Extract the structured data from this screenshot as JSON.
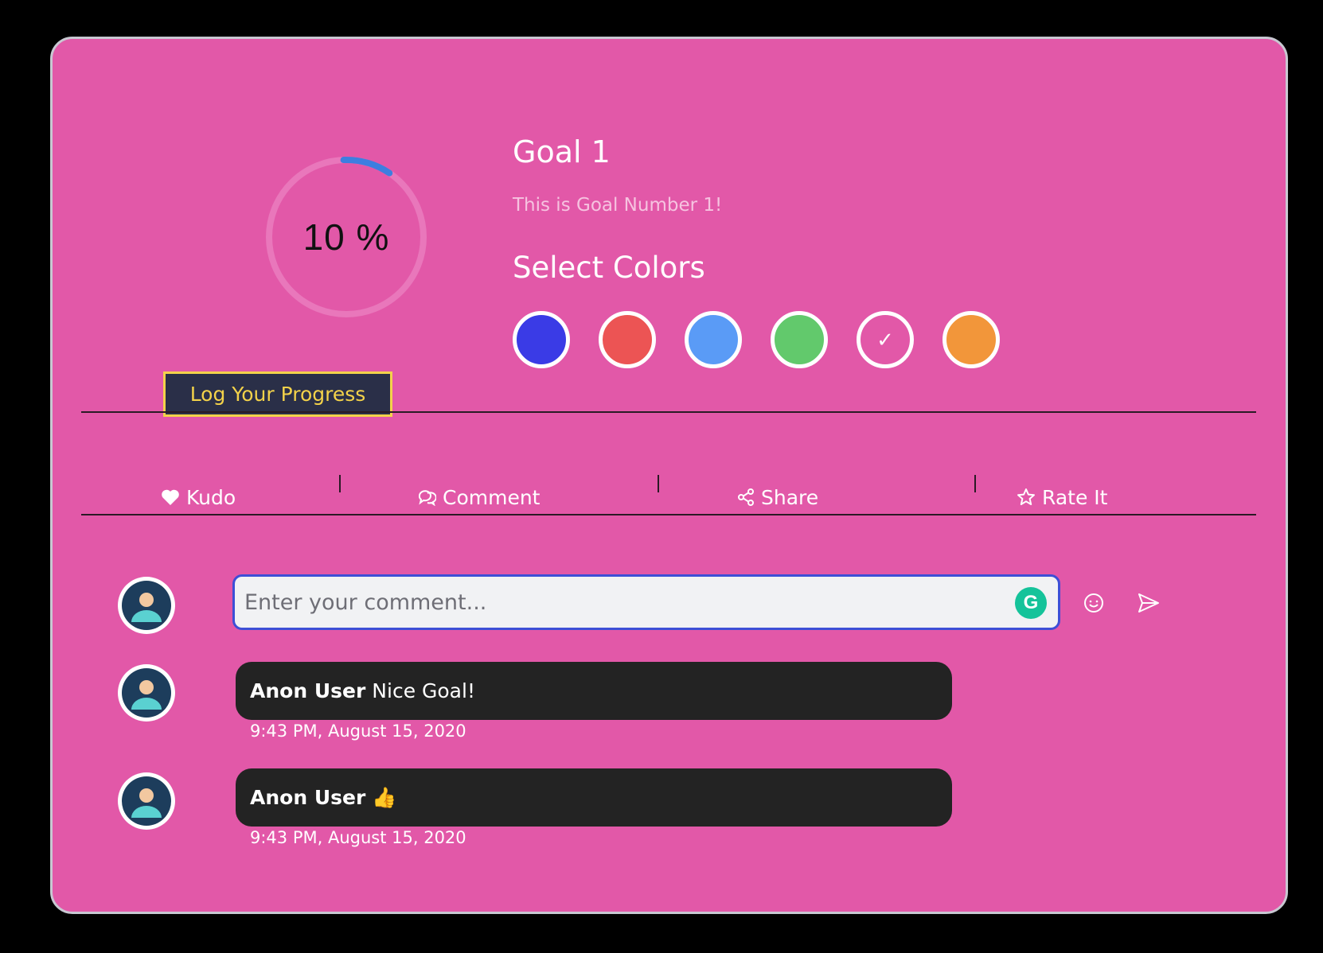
{
  "goal": {
    "progress_text": "10 %",
    "progress_value": 0.1,
    "title": "Goal 1",
    "description": "This is Goal Number 1!",
    "log_button_label": "Log Your Progress",
    "ring_color": "#3d7ee0"
  },
  "colors": {
    "title": "Select Colors",
    "swatches": [
      {
        "name": "blue",
        "hex": "#3a3be6",
        "selected": false
      },
      {
        "name": "red",
        "hex": "#ec5454",
        "selected": false
      },
      {
        "name": "light-blue",
        "hex": "#5a9bf6",
        "selected": false
      },
      {
        "name": "green",
        "hex": "#62c96c",
        "selected": false
      },
      {
        "name": "pink",
        "hex": "#e258a8",
        "selected": true,
        "check": "✓"
      },
      {
        "name": "orange",
        "hex": "#f2963a",
        "selected": false
      }
    ]
  },
  "actions": {
    "kudo": {
      "label": "Kudo",
      "icon": "heart-icon"
    },
    "comment": {
      "label": "Comment",
      "icon": "chat-bubbles-icon"
    },
    "share": {
      "label": "Share",
      "icon": "share-icon"
    },
    "rate": {
      "label": "Rate It",
      "icon": "star-icon"
    }
  },
  "comment_input": {
    "placeholder": "Enter your comment...",
    "grammarly_letter": "G",
    "emoji_icon": "smiley-icon",
    "send_icon": "send-icon"
  },
  "comments": [
    {
      "author": "Anon User",
      "text": "Nice Goal!",
      "time": "9:43 PM, August 15, 2020"
    },
    {
      "author": "Anon User",
      "text": "👍",
      "time": "9:43 PM, August 15, 2020"
    }
  ],
  "theme": {
    "card_bg": "#e258a8",
    "bubble_bg": "#232323",
    "button_bg": "#2a2f48",
    "button_accent": "#f3d24a"
  }
}
